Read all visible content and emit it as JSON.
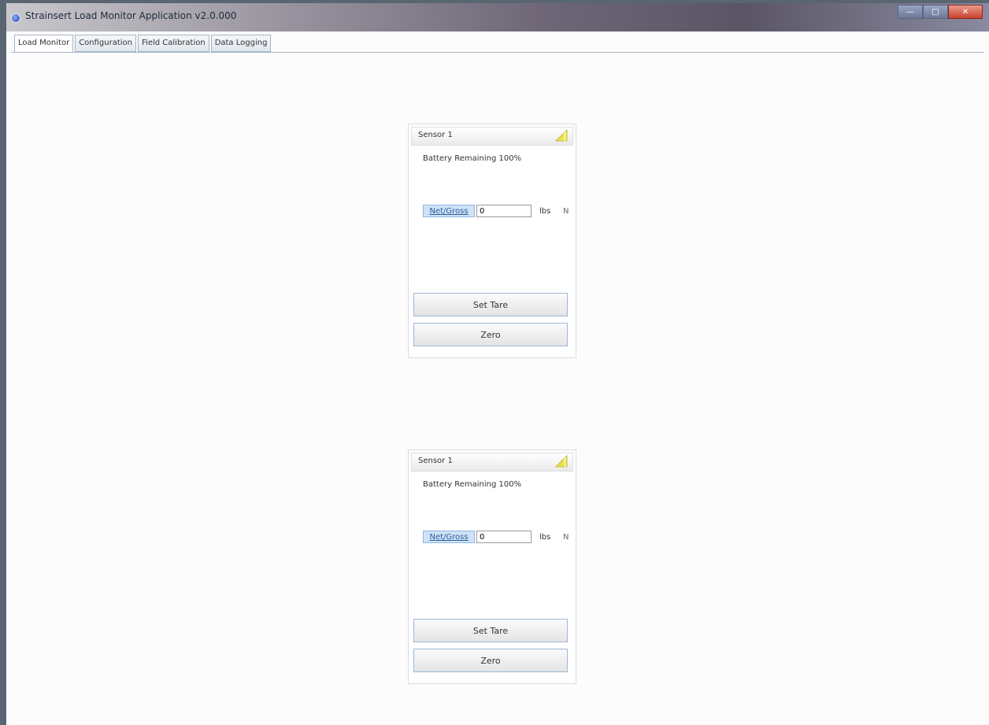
{
  "window": {
    "title": "Strainsert Load Monitor Application v2.0.000"
  },
  "tabs": [
    {
      "label": "Load Monitor",
      "active": true
    },
    {
      "label": "Configuration",
      "active": false
    },
    {
      "label": "Field Calibration",
      "active": false
    },
    {
      "label": "Data Logging",
      "active": false
    }
  ],
  "panels": [
    {
      "sensor_name": "Sensor 1",
      "battery": "Battery Remaining 100%",
      "net_gross_label": "Net/Gross",
      "value": "0",
      "unit_lbs": "lbs",
      "unit_n": "N",
      "set_tare_label": "Set Tare",
      "zero_label": "Zero"
    },
    {
      "sensor_name": "Sensor 1",
      "battery": "Battery Remaining 100%",
      "net_gross_label": "Net/Gross",
      "value": "0",
      "unit_lbs": "lbs",
      "unit_n": "N",
      "set_tare_label": "Set Tare",
      "zero_label": "Zero"
    }
  ],
  "icons": {
    "app": "app-icon",
    "signal": "signal-strength-icon"
  },
  "colors": {
    "accent": "#cfe2f6",
    "signal": "#e8e24a"
  }
}
